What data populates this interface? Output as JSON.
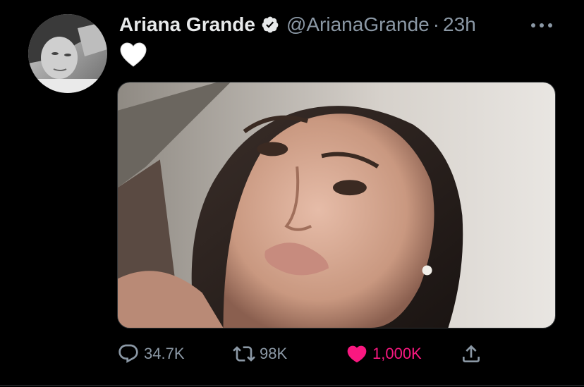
{
  "author": {
    "display_name": "Ariana Grande",
    "handle": "@ArianaGrande",
    "verified": true,
    "avatar_icon": "profile-photo"
  },
  "meta": {
    "separator": "·",
    "time": "23h"
  },
  "tweet": {
    "text_emoji_icon": "white-heart-emoji",
    "media_icon": "selfie-photo"
  },
  "actions": {
    "reply_count": "34.7K",
    "retweet_count": "98K",
    "like_count": "1,000K",
    "liked": true
  },
  "colors": {
    "background": "#000000",
    "primary_text": "#e7e9ea",
    "secondary_text": "#8b98a5",
    "like_active": "#f91880",
    "verified_badge": "#e7e9ea"
  }
}
